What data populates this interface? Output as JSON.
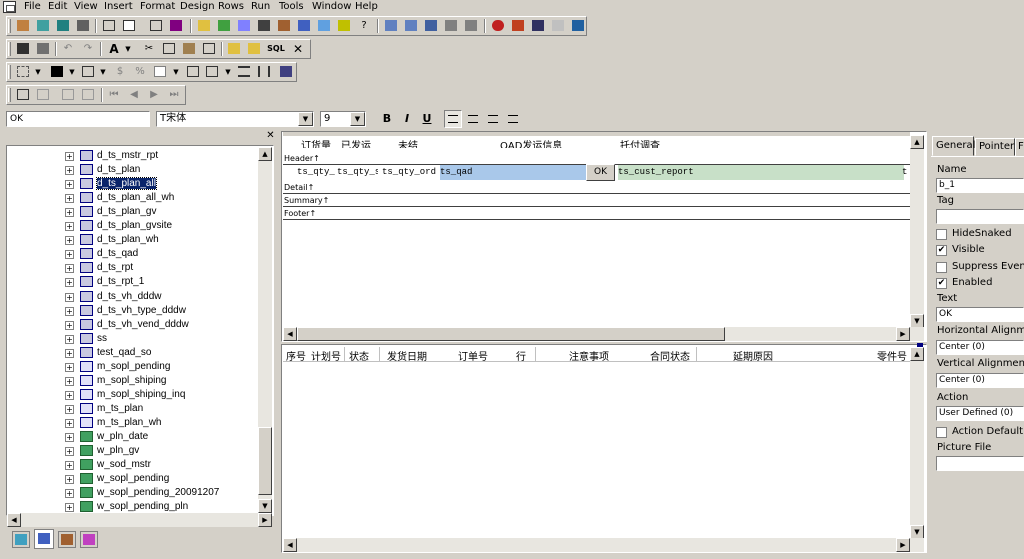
{
  "menubar": [
    "File",
    "Edit",
    "View",
    "Insert",
    "Format",
    "Design",
    "Rows",
    "Run",
    "Tools",
    "Window",
    "Help"
  ],
  "style_bar": {
    "text_value": "OK",
    "font_name": "T宋体",
    "font_size": "9",
    "bold": "B",
    "italic": "I",
    "underline": "U"
  },
  "tree": {
    "items": [
      "d_ts_mstr_rpt",
      "d_ts_plan",
      "d_ts_plan_all",
      "d_ts_plan_all_wh",
      "d_ts_plan_gv",
      "d_ts_plan_gvsite",
      "d_ts_plan_wh",
      "d_ts_qad",
      "d_ts_rpt",
      "d_ts_rpt_1",
      "d_ts_vh_dddw",
      "d_ts_vh_type_dddw",
      "d_ts_vh_vend_dddw",
      "ss",
      "test_qad_so",
      "m_sopl_pending",
      "m_sopl_shiping",
      "m_sopl_shiping_inq",
      "m_ts_plan",
      "m_ts_plan_wh",
      "w_pln_date",
      "w_pln_gv",
      "w_sod_mstr",
      "w_sopl_pending",
      "w_sopl_pending_20091207",
      "w_sopl_pending_pln"
    ],
    "selected": "d_ts_plan_all"
  },
  "design": {
    "headers": [
      "订货量",
      "已发运",
      "未结",
      "QAD发运信息",
      "托付调查"
    ],
    "bands": [
      "Header↑",
      "Detail↑",
      "Summary↑",
      "Footer↑"
    ],
    "fields": [
      "ts_qty_",
      "ts_qty_s",
      "ts_qty_ord",
      "ts_qad",
      "OK",
      "ts_cust_report",
      "t"
    ]
  },
  "preview": {
    "columns": [
      "序号",
      "计划号",
      "状态",
      "发货日期",
      "订单号",
      "行",
      "注意事项",
      "合同状态",
      "延期原因",
      "零件号"
    ]
  },
  "props": {
    "tabs": [
      "General",
      "Pointer",
      "F"
    ],
    "name_label": "Name",
    "name_value": "b_1",
    "tag_label": "Tag",
    "tag_value": "",
    "hide_snaked": "HideSnaked",
    "visible": "Visible",
    "suppress_event": "Suppress Event",
    "enabled": "Enabled",
    "text_label": "Text",
    "text_value": "OK",
    "halign_label": "Horizontal Alignment",
    "halign_value": "Center (0)",
    "valign_label": "Vertical Alignment",
    "valign_value": "Center (0)",
    "action_label": "Action",
    "action_value": "User Defined (0)",
    "action_default": "Action Default Pic",
    "picture_label": "Picture File",
    "picture_value": "",
    "check_visible": "✔",
    "check_enabled": "✔"
  },
  "colors": {
    "selected_field": "#a9c8ea",
    "report_field": "#c8e0c8",
    "highlight": "#0a246a"
  }
}
